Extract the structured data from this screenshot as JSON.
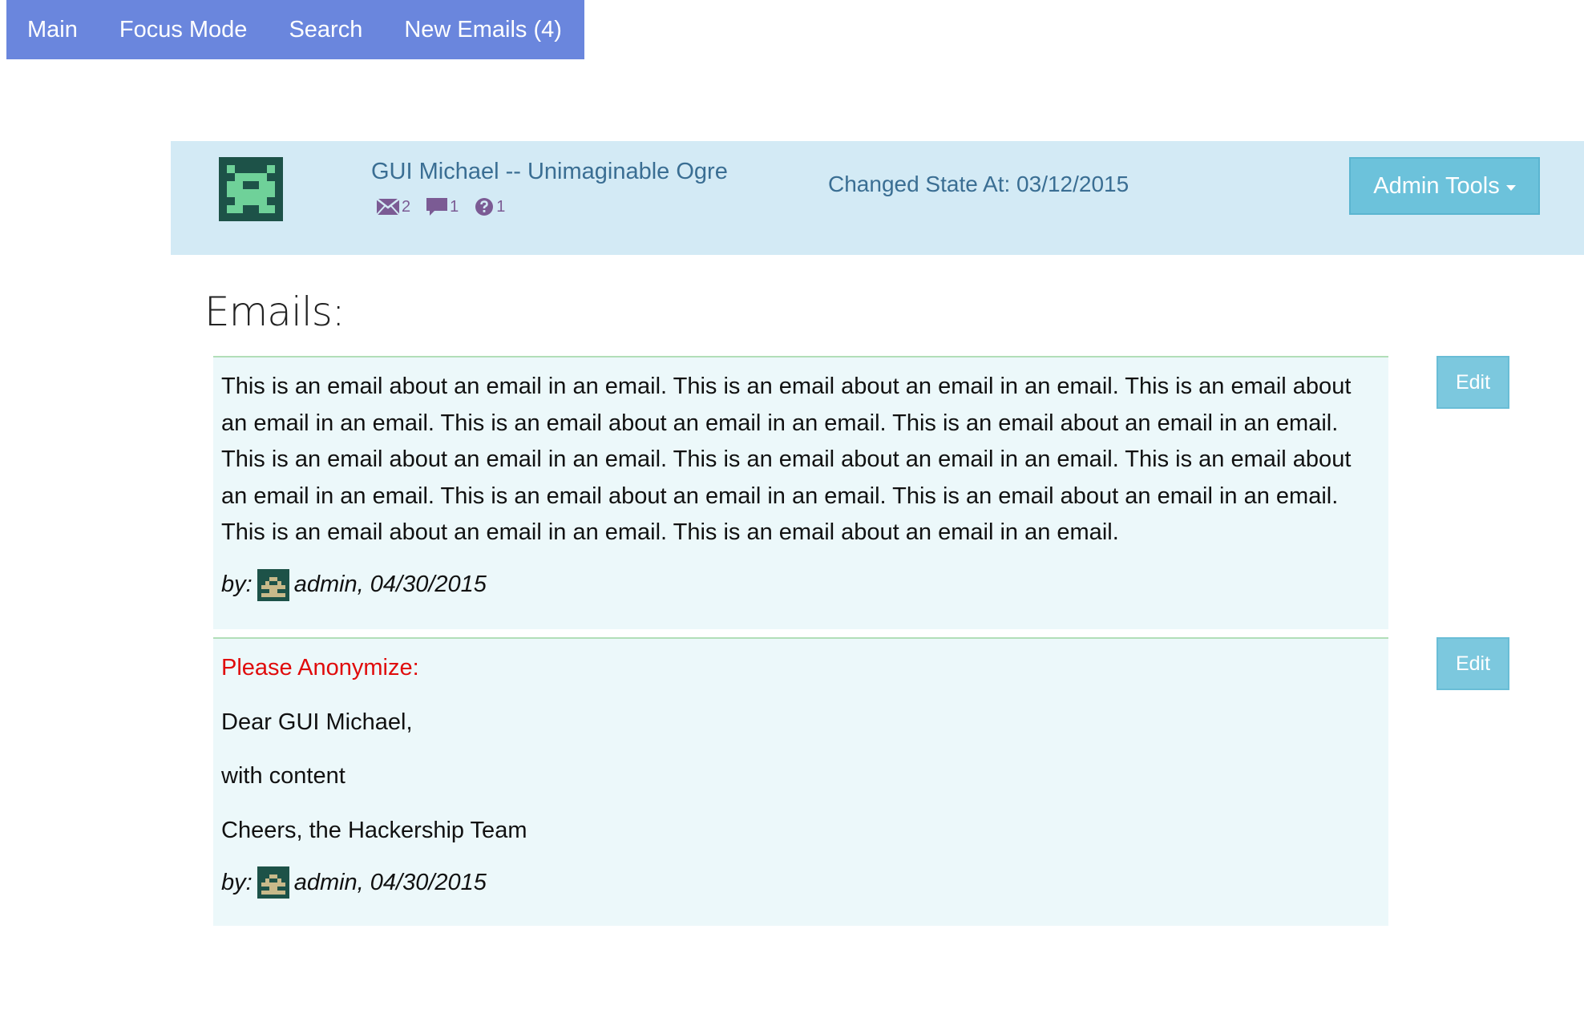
{
  "nav": {
    "items": [
      {
        "label": "Main"
      },
      {
        "label": "Focus Mode"
      },
      {
        "label": "Search"
      },
      {
        "label": "New Emails (4)"
      }
    ]
  },
  "applicant": {
    "name": "GUI Michael -- Unimaginable Ogre",
    "stats": {
      "emails": "2",
      "comments": "1",
      "questions": "1"
    },
    "state_text": "Changed State At: 03/12/2015",
    "admin_tools_label": "Admin Tools"
  },
  "emails_heading": "Emails:",
  "emails": [
    {
      "body": "This is an email about an email in an email. This is an email about an email in an email. This is an email about an email in an email. This is an email about an email in an email. This is an email about an email in an email. This is an email about an email in an email. This is an email about an email in an email. This is an email about an email in an email. This is an email about an email in an email. This is an email about an email in an email. This is an email about an email in an email. This is an email about an email in an email.",
      "by_label": "by:",
      "author_date": "admin, 04/30/2015",
      "edit_label": "Edit"
    },
    {
      "warning": "Please Anonymize:",
      "lines": [
        "Dear GUI Michael,",
        "with content",
        "Cheers, the Hackership Team"
      ],
      "by_label": "by:",
      "author_date": "admin, 04/30/2015",
      "edit_label": "Edit"
    }
  ],
  "colors": {
    "nav_bg": "#6a86dd",
    "header_bg": "#d3eaf5",
    "email_bg": "#ecf8fa",
    "button_bg": "#6cc2db",
    "warning": "#e00b0b"
  },
  "icons": {
    "avatar": "identicon-avatar",
    "emails": "envelope-icon",
    "comments": "comment-icon",
    "questions": "question-circle-icon",
    "caret": "caret-down-icon"
  }
}
